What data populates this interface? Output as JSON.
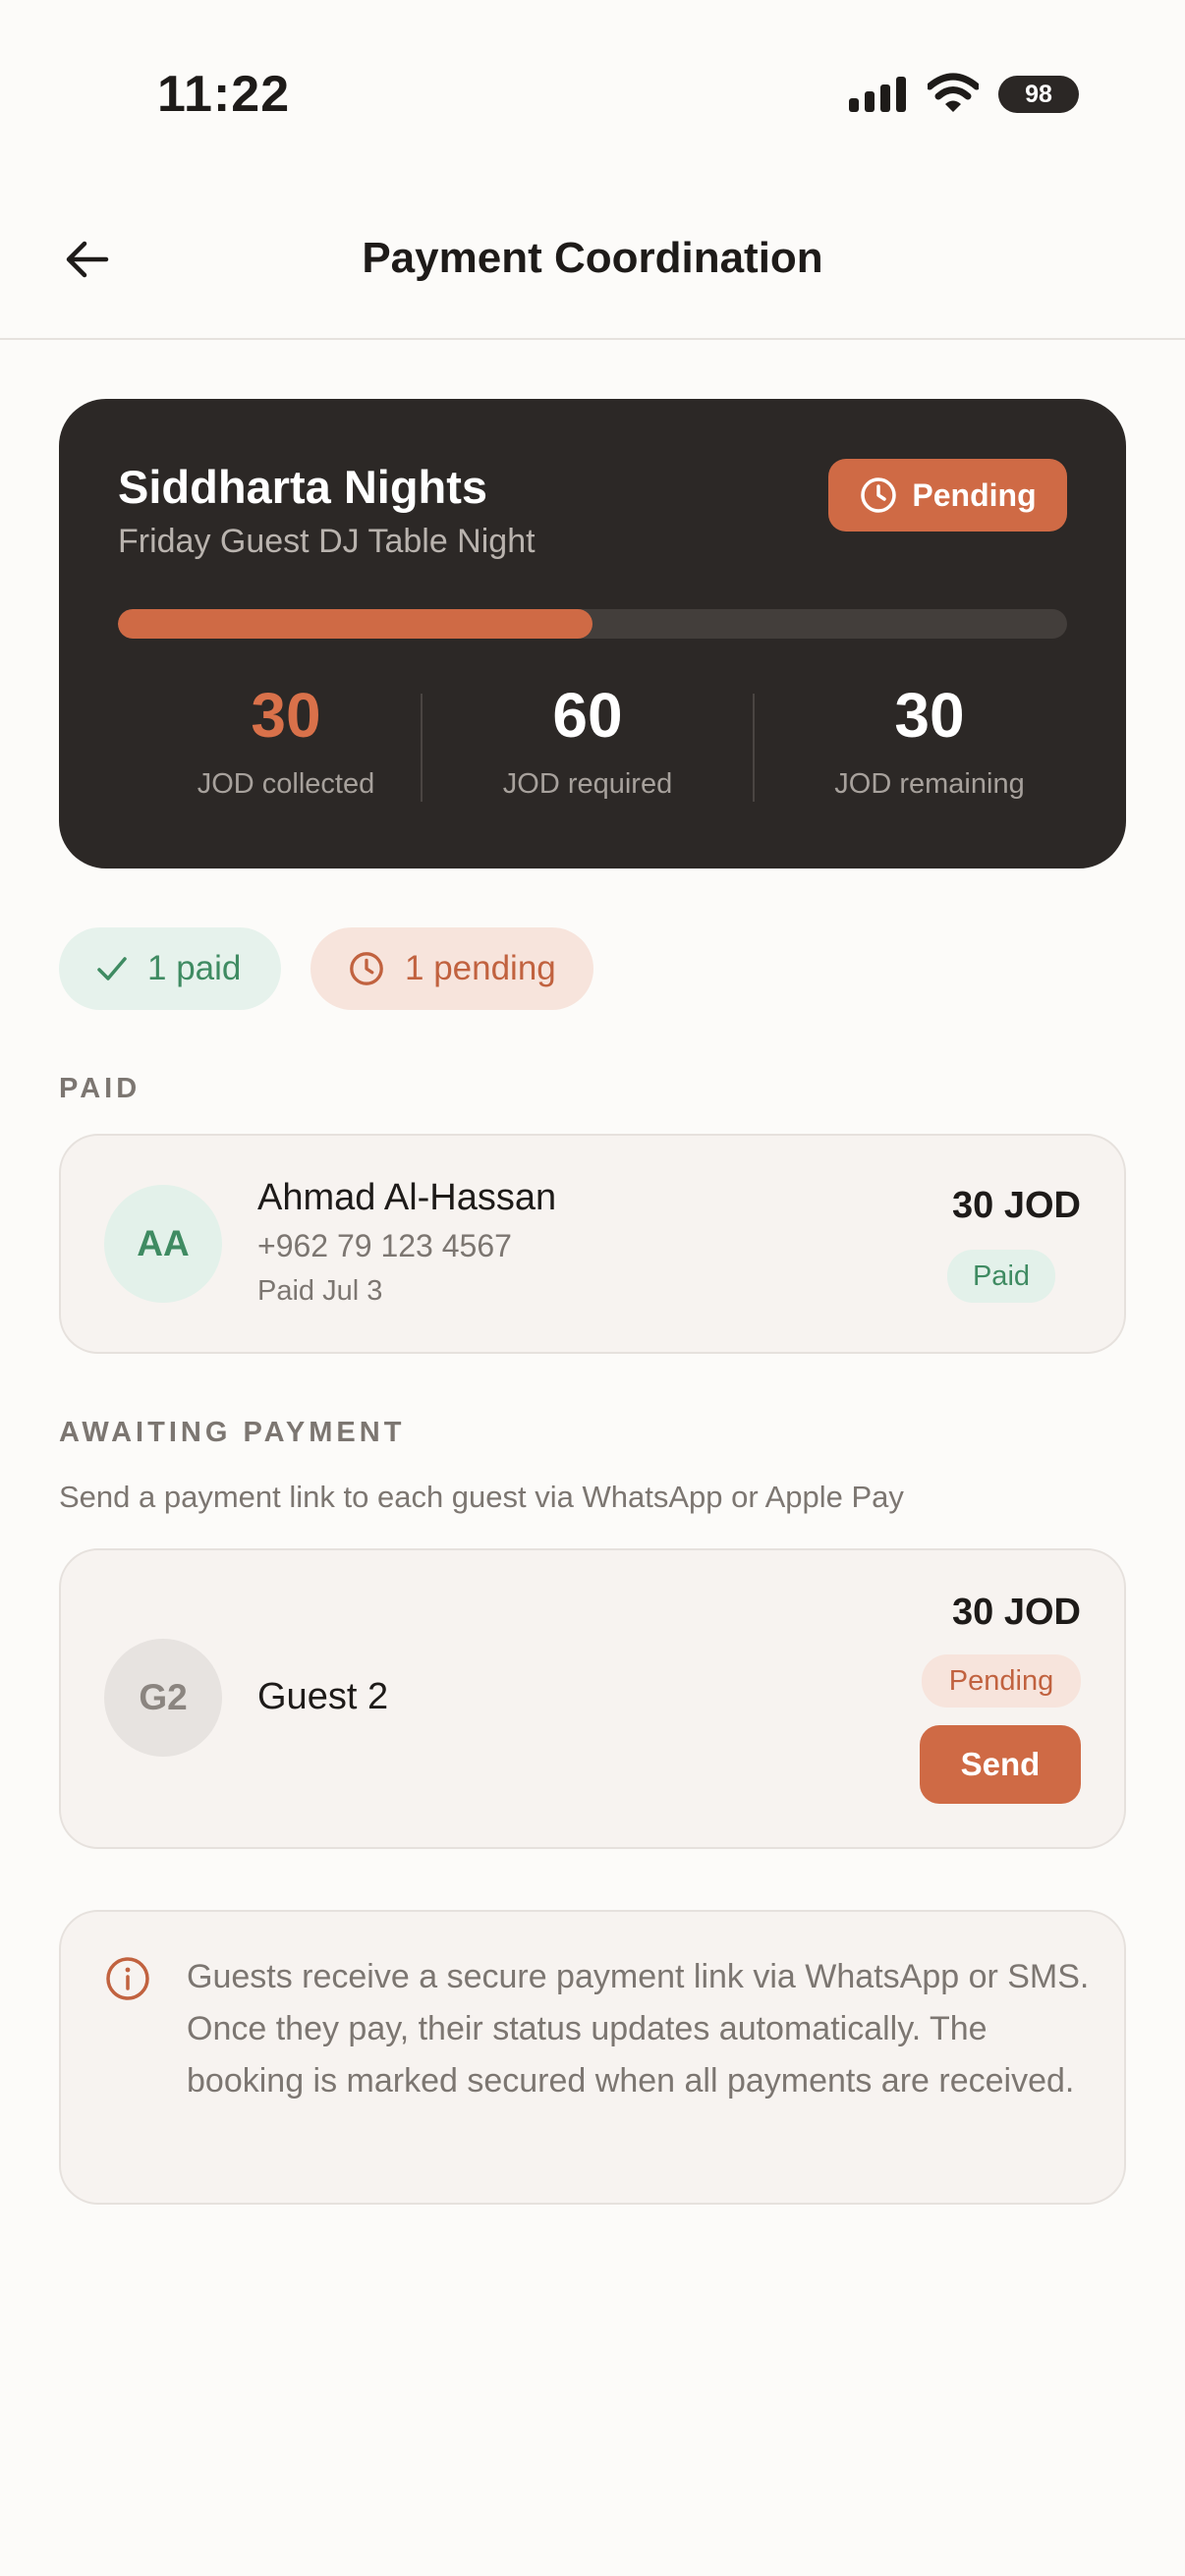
{
  "status_bar": {
    "time": "11:22",
    "battery": "98"
  },
  "header": {
    "title": "Payment Coordination"
  },
  "summary": {
    "venue": "Siddharta Nights",
    "event": "Friday Guest DJ Table Night",
    "status": "Pending",
    "progress_fraction": 0.5,
    "stats": [
      {
        "value": "30",
        "label": "JOD collected"
      },
      {
        "value": "60",
        "label": "JOD required"
      },
      {
        "value": "30",
        "label": "JOD remaining"
      }
    ]
  },
  "chips": {
    "paid": "1 paid",
    "pending": "1 pending"
  },
  "paid_section": {
    "label": "PAID",
    "guest": {
      "initials": "AA",
      "name": "Ahmad Al-Hassan",
      "phone": "+962 79 123 4567",
      "paid_date": "Paid Jul 3",
      "amount": "30 JOD",
      "status": "Paid"
    }
  },
  "awaiting_section": {
    "label": "AWAITING PAYMENT",
    "subtitle": "Send a payment link to each guest via WhatsApp or Apple Pay",
    "guest": {
      "initials": "G2",
      "name": "Guest 2",
      "amount": "30 JOD",
      "status": "Pending",
      "action": "Send"
    }
  },
  "info": {
    "text": "Guests receive a secure payment link via WhatsApp or SMS. Once they pay, their status updates automatically. The booking is marked secured when all payments are received."
  },
  "colors": {
    "accent": "#cf6a45",
    "card_dark": "#2c2826",
    "success": "#3f8b62",
    "background": "#fcfbf9"
  }
}
